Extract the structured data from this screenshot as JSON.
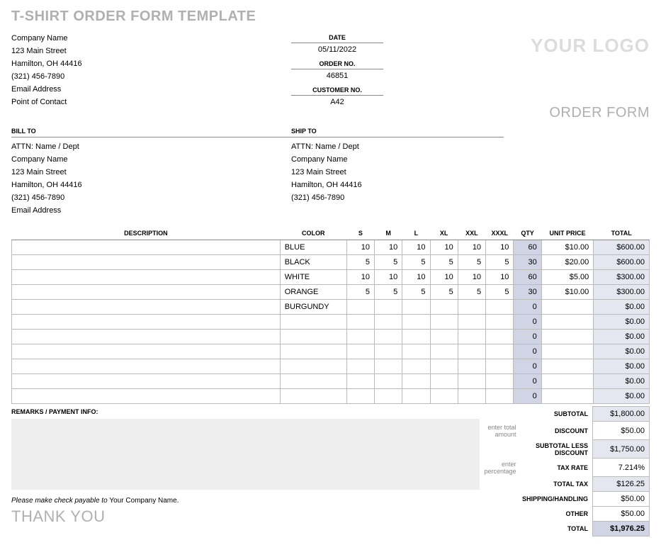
{
  "title": "T-SHIRT ORDER FORM TEMPLATE",
  "logo_text": "YOUR LOGO",
  "order_form_text": "ORDER FORM",
  "company": {
    "name": "Company Name",
    "street": "123 Main Street",
    "citystate": "Hamilton, OH 44416",
    "phone": "(321) 456-7890",
    "email": "Email Address",
    "contact": "Point of Contact"
  },
  "meta": {
    "date_label": "DATE",
    "date": "05/11/2022",
    "order_no_label": "ORDER NO.",
    "order_no": "46851",
    "customer_no_label": "CUSTOMER NO.",
    "customer_no": "A42"
  },
  "billto_label": "BILL TO",
  "shipto_label": "SHIP TO",
  "billto": {
    "attn": "ATTN: Name / Dept",
    "company": "Company Name",
    "street": "123 Main Street",
    "citystate": "Hamilton, OH 44416",
    "phone": "(321) 456-7890",
    "email": "Email Address"
  },
  "shipto": {
    "attn": "ATTN: Name / Dept",
    "company": "Company Name",
    "street": "123 Main Street",
    "citystate": "Hamilton, OH 44416",
    "phone": "(321) 456-7890"
  },
  "headers": {
    "description": "DESCRIPTION",
    "color": "COLOR",
    "s": "S",
    "m": "M",
    "l": "L",
    "xl": "XL",
    "xxl": "XXL",
    "xxxl": "XXXL",
    "qty": "QTY",
    "unitprice": "UNIT PRICE",
    "total": "TOTAL"
  },
  "rows": [
    {
      "desc": "",
      "color": "BLUE",
      "s": "10",
      "m": "10",
      "l": "10",
      "xl": "10",
      "xxl": "10",
      "xxxl": "10",
      "qty": "60",
      "price": "$10.00",
      "total": "$600.00"
    },
    {
      "desc": "",
      "color": "BLACK",
      "s": "5",
      "m": "5",
      "l": "5",
      "xl": "5",
      "xxl": "5",
      "xxxl": "5",
      "qty": "30",
      "price": "$20.00",
      "total": "$600.00"
    },
    {
      "desc": "",
      "color": "WHITE",
      "s": "10",
      "m": "10",
      "l": "10",
      "xl": "10",
      "xxl": "10",
      "xxxl": "10",
      "qty": "60",
      "price": "$5.00",
      "total": "$300.00"
    },
    {
      "desc": "",
      "color": "ORANGE",
      "s": "5",
      "m": "5",
      "l": "5",
      "xl": "5",
      "xxl": "5",
      "xxxl": "5",
      "qty": "30",
      "price": "$10.00",
      "total": "$300.00"
    },
    {
      "desc": "",
      "color": "BURGUNDY",
      "s": "",
      "m": "",
      "l": "",
      "xl": "",
      "xxl": "",
      "xxxl": "",
      "qty": "0",
      "price": "",
      "total": "$0.00"
    },
    {
      "desc": "",
      "color": "",
      "s": "",
      "m": "",
      "l": "",
      "xl": "",
      "xxl": "",
      "xxxl": "",
      "qty": "0",
      "price": "",
      "total": "$0.00"
    },
    {
      "desc": "",
      "color": "",
      "s": "",
      "m": "",
      "l": "",
      "xl": "",
      "xxl": "",
      "xxxl": "",
      "qty": "0",
      "price": "",
      "total": "$0.00"
    },
    {
      "desc": "",
      "color": "",
      "s": "",
      "m": "",
      "l": "",
      "xl": "",
      "xxl": "",
      "xxxl": "",
      "qty": "0",
      "price": "",
      "total": "$0.00"
    },
    {
      "desc": "",
      "color": "",
      "s": "",
      "m": "",
      "l": "",
      "xl": "",
      "xxl": "",
      "xxxl": "",
      "qty": "0",
      "price": "",
      "total": "$0.00"
    },
    {
      "desc": "",
      "color": "",
      "s": "",
      "m": "",
      "l": "",
      "xl": "",
      "xxl": "",
      "xxxl": "",
      "qty": "0",
      "price": "",
      "total": "$0.00"
    },
    {
      "desc": "",
      "color": "",
      "s": "",
      "m": "",
      "l": "",
      "xl": "",
      "xxl": "",
      "xxxl": "",
      "qty": "0",
      "price": "",
      "total": "$0.00"
    }
  ],
  "remarks_label": "REMARKS / PAYMENT INFO:",
  "payable_prefix": "Please make check payable to ",
  "payable_name": "Your Company Name.",
  "thankyou": "THANK YOU",
  "totals": {
    "subtotal_label": "SUBTOTAL",
    "subtotal": "$1,800.00",
    "discount_hint": "enter total amount",
    "discount_label": "DISCOUNT",
    "discount": "$50.00",
    "lessdisc_label": "SUBTOTAL LESS DISCOUNT",
    "lessdisc": "$1,750.00",
    "taxrate_hint": "enter percentage",
    "taxrate_label": "TAX RATE",
    "taxrate": "7.214%",
    "totaltax_label": "TOTAL TAX",
    "totaltax": "$126.25",
    "shipping_label": "SHIPPING/HANDLING",
    "shipping": "$50.00",
    "other_label": "OTHER",
    "other": "$50.00",
    "grand_label": "TOTAL",
    "grand": "$1,976.25"
  }
}
